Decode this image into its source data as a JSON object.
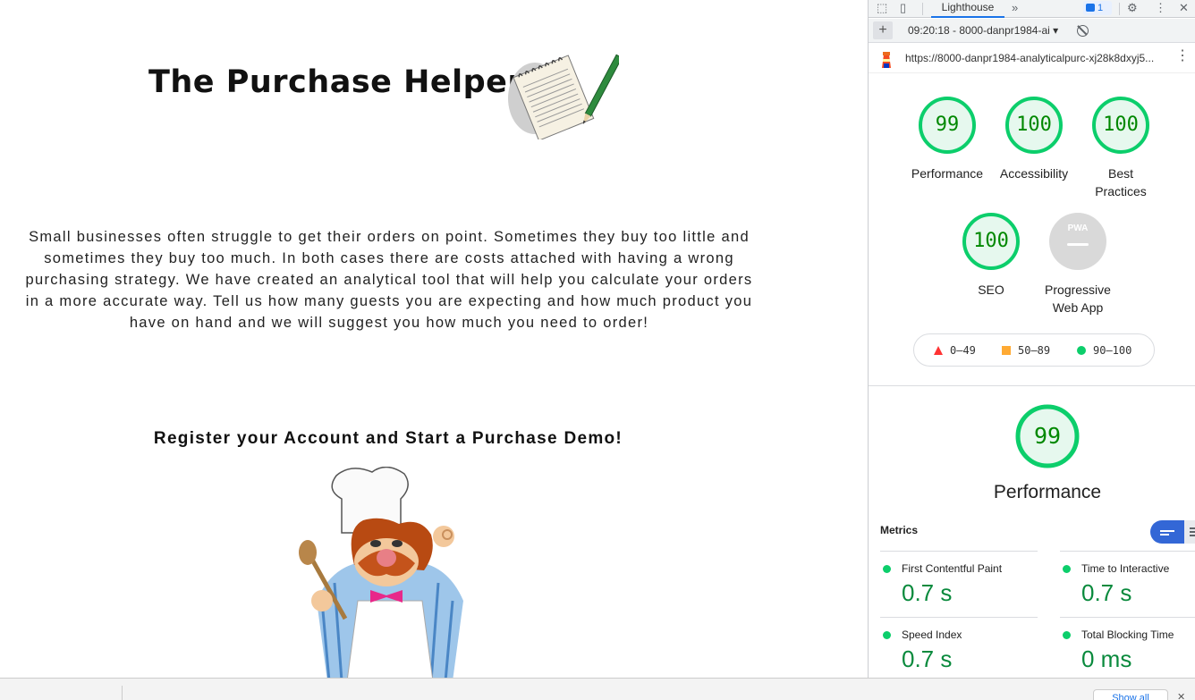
{
  "site": {
    "title": "The Purchase Helper",
    "intro": "Small businesses often struggle to get their orders on point. Sometimes they buy too little and sometimes they buy too much. In both cases there are costs attached with having a wrong purchasing strategy. We have created an analytical tool that will help you calculate your orders in a more accurate way. Tell us how many guests you are expecting and how much product you have on hand and we will suggest you how much you need to order!",
    "cta": "Register your Account and Start a Purchase Demo!"
  },
  "devtools": {
    "active_tab": "Lighthouse",
    "issues_count": "1",
    "report_select": "09:20:18 - 8000-danpr1984-ai",
    "url": "https://8000-danpr1984-analyticalpurc-xj28k8dxyj5...",
    "colors": {
      "pass": "#0cce6b",
      "average": "#ffaa33",
      "fail": "#ff3333",
      "accent": "#1a73e8"
    },
    "categories": [
      {
        "score": 99,
        "label": "Performance"
      },
      {
        "score": 100,
        "label": "Accessibility"
      },
      {
        "score": 100,
        "label": "Best Practices"
      },
      {
        "score": 100,
        "label": "SEO"
      },
      {
        "score": "PWA",
        "label": "Progressive Web App"
      }
    ],
    "legend": [
      {
        "icon": "fail-triangle-icon",
        "range": "0–49"
      },
      {
        "icon": "average-square-icon",
        "range": "50–89"
      },
      {
        "icon": "pass-circle-icon",
        "range": "90–100"
      }
    ],
    "performance": {
      "score": 99,
      "title": "Performance",
      "metrics_heading": "Metrics",
      "metrics": [
        {
          "label": "First Contentful Paint",
          "value": "0.7 s"
        },
        {
          "label": "Time to Interactive",
          "value": "0.7 s"
        },
        {
          "label": "Speed Index",
          "value": "0.7 s"
        },
        {
          "label": "Total Blocking Time",
          "value": "0 ms"
        }
      ]
    }
  },
  "bottombar": {
    "show_all": "Show all"
  }
}
